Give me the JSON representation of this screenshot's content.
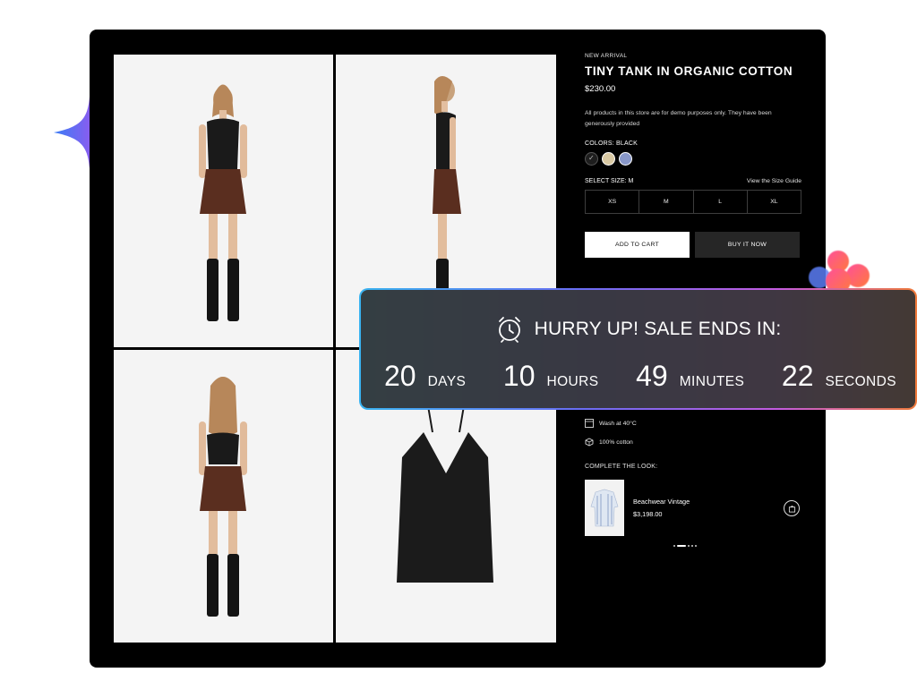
{
  "product": {
    "eyebrow": "NEW ARRIVAL",
    "title": "TINY TANK IN ORGANIC COTTON",
    "price": "$230.00",
    "notice": "All products in this store are for demo purposes only. They have been generously provided",
    "color_label": "COLORS: BLACK",
    "colors": [
      {
        "name": "black",
        "hex": "#1e1e1e",
        "selected": true
      },
      {
        "name": "beige",
        "hex": "#d9c9a3",
        "selected": false
      },
      {
        "name": "blue",
        "hex": "#8897c8",
        "selected": false
      }
    ],
    "size_label": "SELECT SIZE: M",
    "size_guide": "View the Size Guide",
    "sizes": [
      "XS",
      "M",
      "L",
      "XL"
    ],
    "add_to_cart": "ADD TO CART",
    "buy_now": "BUY IT NOW",
    "features": [
      "Wash at 40°C",
      "100% cotton"
    ],
    "complete_look": {
      "title": "COMPLETE THE LOOK:",
      "item_name": "Beachwear Vintage",
      "item_price": "$3,198.00"
    },
    "carousel": {
      "count": 5,
      "active_index": 1
    }
  },
  "countdown": {
    "title": "HURRY UP! SALE ENDS IN:",
    "units": [
      {
        "value": "20",
        "label": "DAYS"
      },
      {
        "value": "10",
        "label": "HOURS"
      },
      {
        "value": "49",
        "label": "MINUTES"
      },
      {
        "value": "22",
        "label": "SECONDS"
      }
    ]
  },
  "icons": {
    "clock": "alarm-clock-icon",
    "wash": "wash-icon",
    "fabric": "fabric-icon",
    "cart": "shopping-bag-icon"
  },
  "colors": {
    "frame": "#000000",
    "gallery_bg": "#f4f4f4",
    "button_primary": "#ffffff",
    "button_secondary": "#262626",
    "overlay_bg": "#343434",
    "gradient_start": "#39b3f0",
    "gradient_end": "#f07a3a"
  }
}
